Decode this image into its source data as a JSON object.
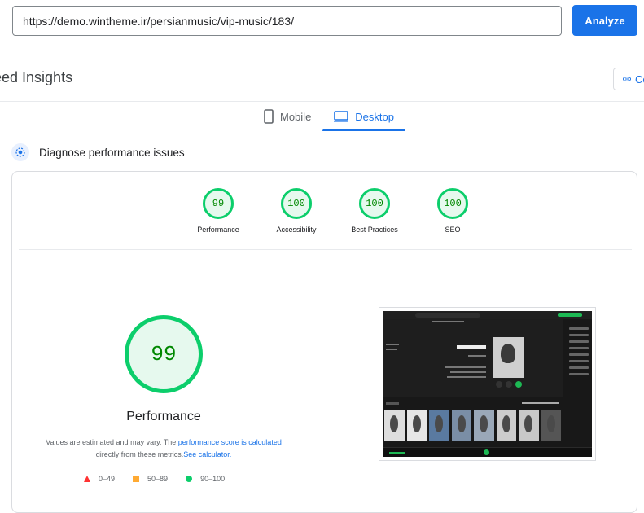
{
  "header": {
    "url_value": "https://demo.wintheme.ir/persianmusic/vip-music/183/",
    "analyze_label": "Analyze",
    "title": "eed Insights",
    "copy_label": "Co"
  },
  "tabs": [
    {
      "label": "Mobile",
      "icon": "smartphone-icon",
      "active": false
    },
    {
      "label": "Desktop",
      "icon": "monitor-icon",
      "active": true
    }
  ],
  "diagnose": {
    "label": "Diagnose performance issues"
  },
  "scores": [
    {
      "value": "99",
      "label": "Performance"
    },
    {
      "value": "100",
      "label": "Accessibility"
    },
    {
      "value": "100",
      "label": "Best Practices"
    },
    {
      "value": "100",
      "label": "SEO"
    }
  ],
  "performance": {
    "score": "99",
    "label": "Performance",
    "note_prefix": "Values are estimated and may vary. The ",
    "note_link1": "performance score is calculated",
    "note_middle": " directly from these metrics.",
    "note_link2": "See calculator."
  },
  "legend": [
    {
      "range": "0–49",
      "shape": "triangle",
      "color": "#ff3333"
    },
    {
      "range": "50–89",
      "shape": "square",
      "color": "#ffaa33"
    },
    {
      "range": "90–100",
      "shape": "circle",
      "color": "#0cce6b"
    }
  ],
  "colors": {
    "accent": "#1a73e8",
    "pass": "#0cce6b",
    "pass_text": "#008800"
  }
}
